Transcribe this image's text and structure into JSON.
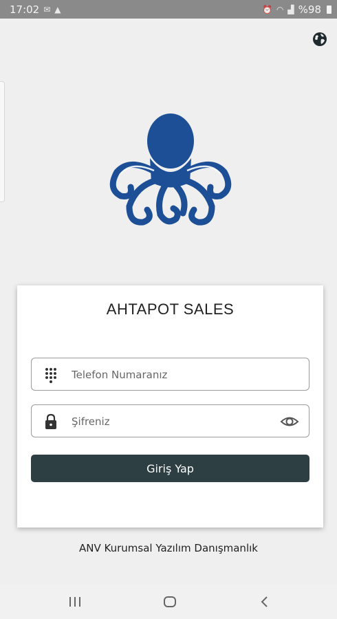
{
  "status_bar": {
    "time": "17:02",
    "battery": "%98"
  },
  "login": {
    "app_title": "AHTAPOT SALES",
    "phone_placeholder": "Telefon Numaranız",
    "password_placeholder": "Şifreniz",
    "submit_label": "Giriş Yap"
  },
  "footer": {
    "company": "ANV Kurumsal Yazılım Danışmanlık"
  },
  "colors": {
    "brand_blue": "#1c4f96",
    "button_dark": "#2d3f43",
    "background": "#efefef"
  },
  "icons": [
    "globe-icon",
    "octopus-logo",
    "dialpad-icon",
    "lock-icon",
    "eye-icon",
    "recent-apps-icon",
    "home-icon",
    "back-icon"
  ]
}
